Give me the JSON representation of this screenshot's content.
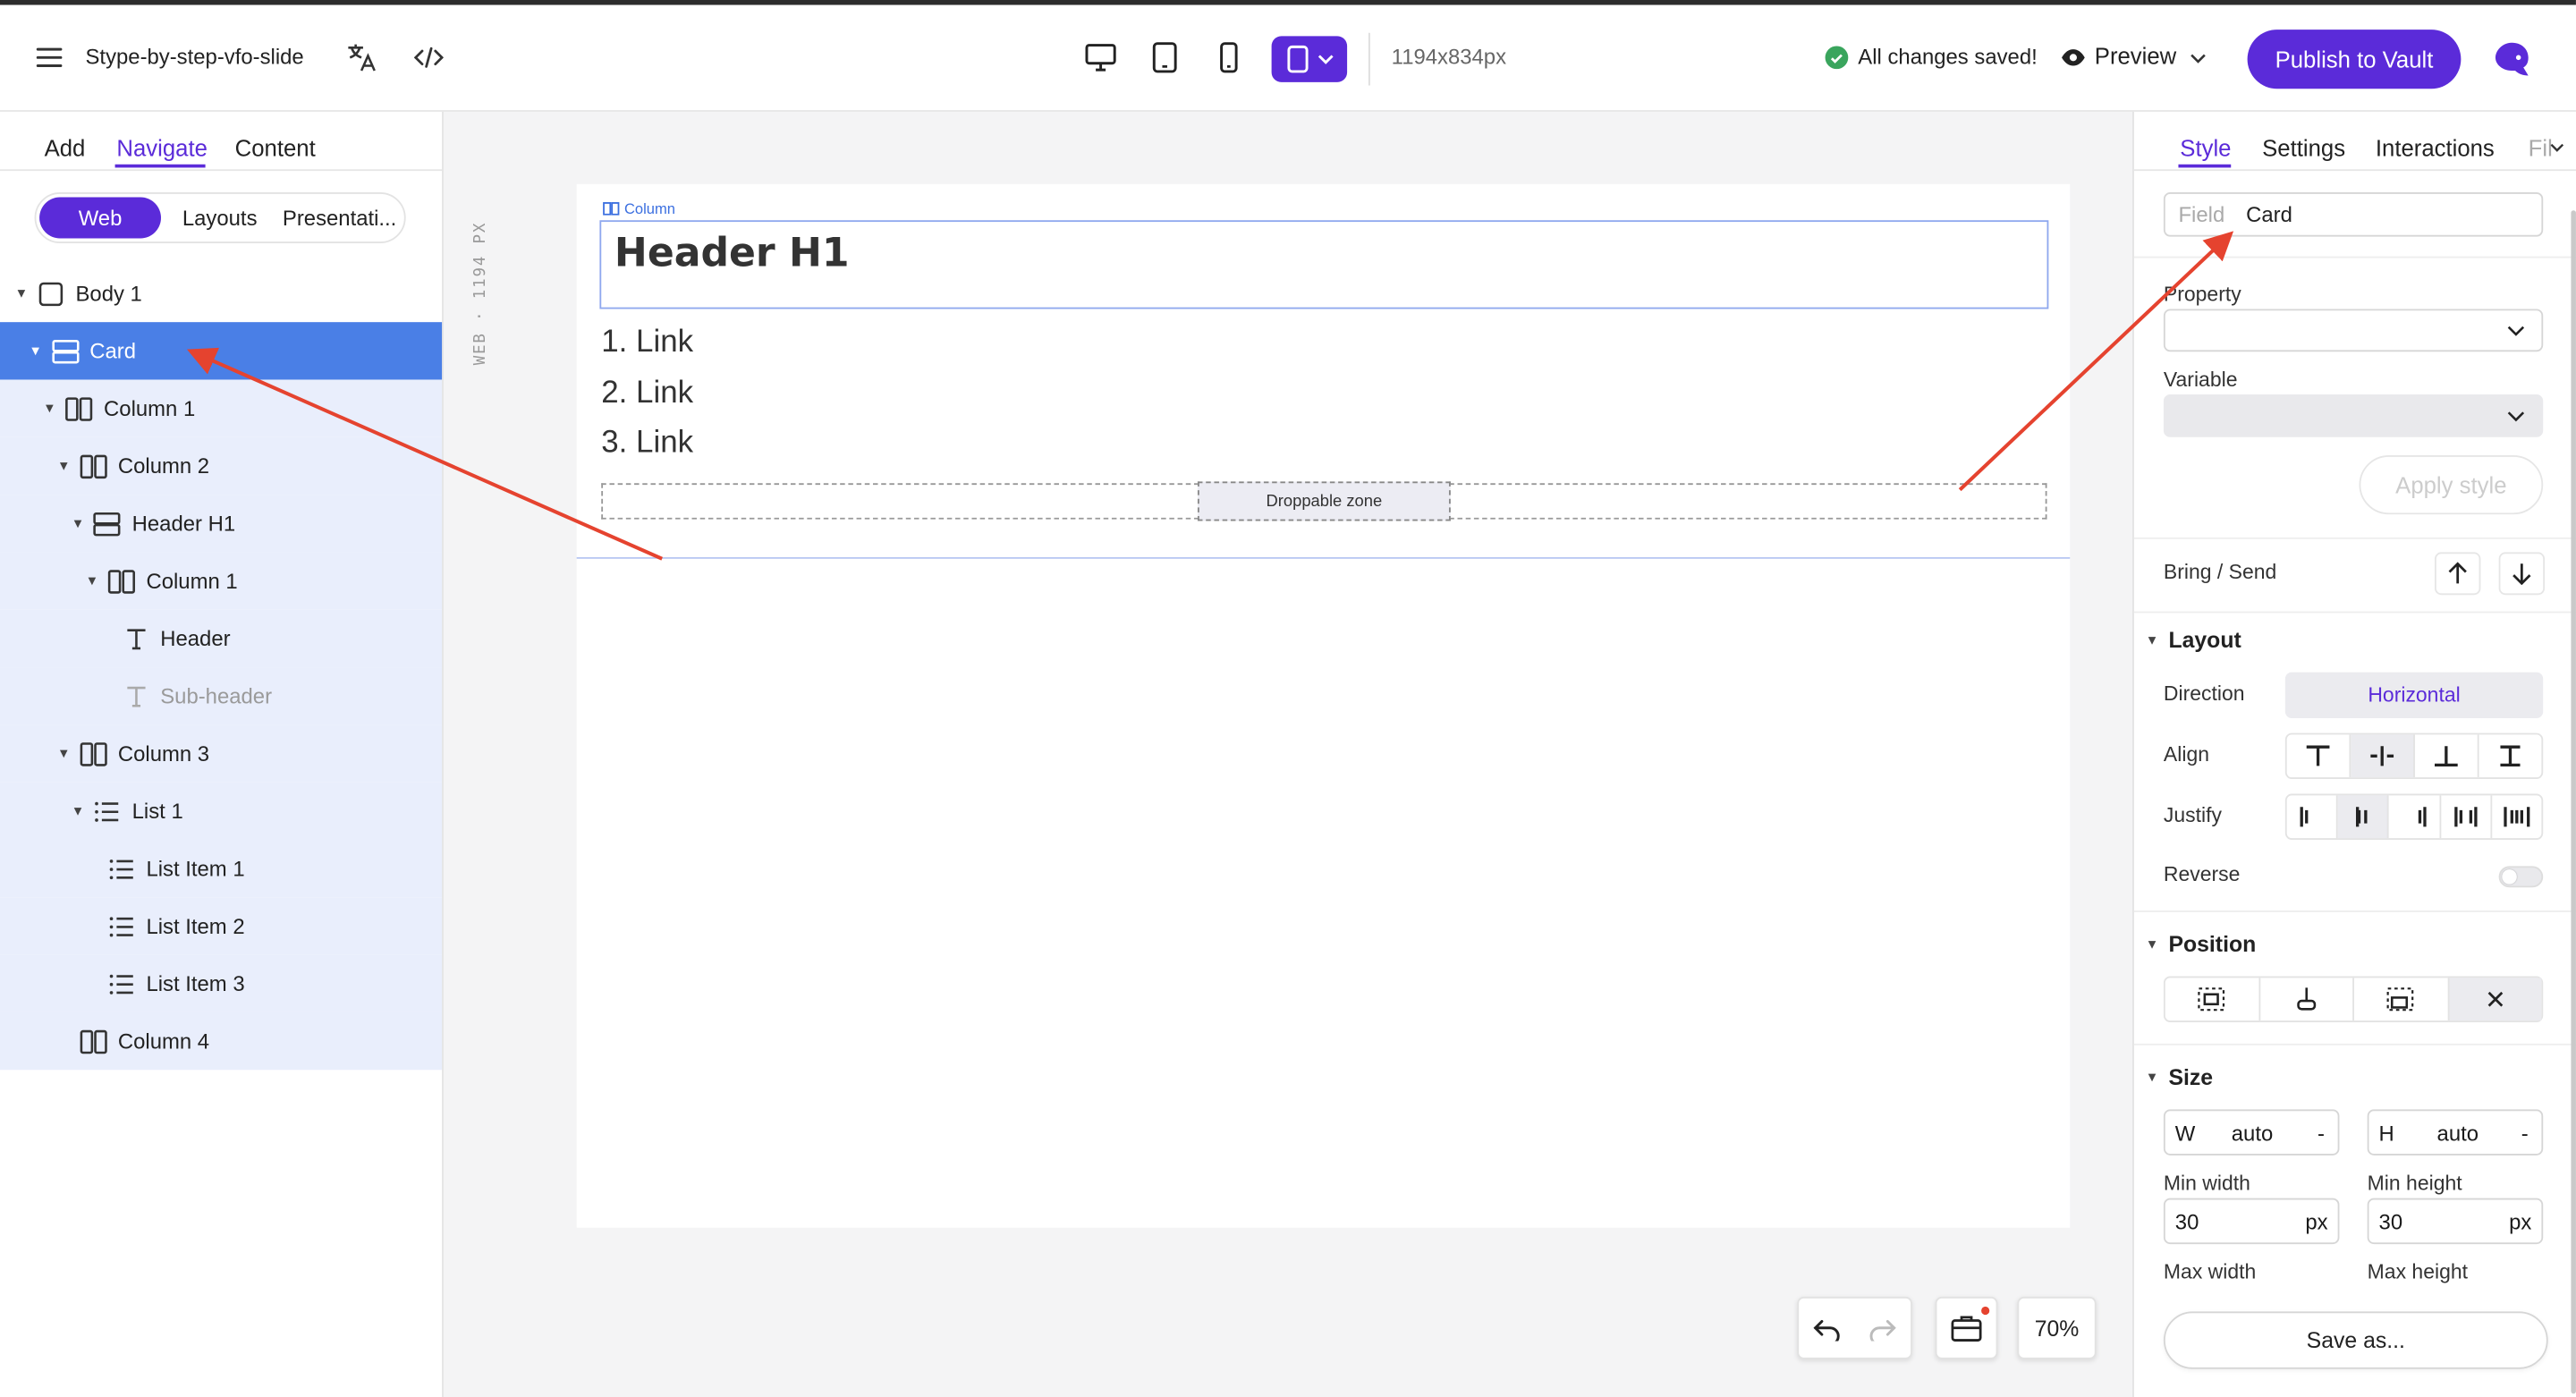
{
  "toolbar": {
    "doc_name": "Stype-by-step-vfo-slide",
    "dimensions": "1194x834px",
    "save_status": "All changes saved!",
    "preview_label": "Preview",
    "publish_label": "Publish to Vault"
  },
  "left_panel": {
    "tabs": [
      "Add",
      "Navigate",
      "Content"
    ],
    "active_tab": "Navigate",
    "modes": [
      "Web",
      "Layouts",
      "Presentati..."
    ],
    "active_mode": "Web",
    "tree": [
      {
        "label": "Body 1",
        "icon": "square-icon",
        "depth": 0
      },
      {
        "label": "Card",
        "icon": "card-icon",
        "depth": 1
      },
      {
        "label": "Column 1",
        "icon": "columns-icon",
        "depth": 2
      },
      {
        "label": "Column 2",
        "icon": "columns-icon",
        "depth": 3
      },
      {
        "label": "Header H1",
        "icon": "card-icon",
        "depth": 4
      },
      {
        "label": "Column 1",
        "icon": "columns-icon",
        "depth": 5
      },
      {
        "label": "Header",
        "icon": "text-icon",
        "depth": 6
      },
      {
        "label": "Sub-header",
        "icon": "text-icon",
        "depth": 6
      },
      {
        "label": "Column 3",
        "icon": "columns-icon",
        "depth": 3
      },
      {
        "label": "List 1",
        "icon": "list-icon",
        "depth": 4
      },
      {
        "label": "List Item 1",
        "icon": "list-icon",
        "depth": 5
      },
      {
        "label": "List Item 2",
        "icon": "list-icon",
        "depth": 5
      },
      {
        "label": "List Item 3",
        "icon": "list-icon",
        "depth": 5
      },
      {
        "label": "Column 4",
        "icon": "columns-icon",
        "depth": 3
      }
    ]
  },
  "canvas": {
    "ruler_label": "WEB · 1194 PX",
    "column_tag": "Column",
    "header_text": "Header H1",
    "links": [
      "1. Link",
      "2. Link",
      "3. Link"
    ],
    "drop_zone": "Droppable zone",
    "zoom": "70%"
  },
  "right_panel": {
    "tabs": [
      "Style",
      "Settings",
      "Interactions",
      "Fil"
    ],
    "active_tab": "Style",
    "field_label": "Field",
    "field_value": "Card",
    "property_label": "Property",
    "variable_label": "Variable",
    "apply_label": "Apply style",
    "bring_send_label": "Bring / Send",
    "layout_title": "Layout",
    "direction_label": "Direction",
    "direction_value": "Horizontal",
    "align_label": "Align",
    "justify_label": "Justify",
    "reverse_label": "Reverse",
    "position_title": "Position",
    "size_title": "Size",
    "w_label": "W",
    "w_value": "auto",
    "h_label": "H",
    "h_value": "auto",
    "dash": "-",
    "min_width_label": "Min width",
    "min_width_value": "30",
    "min_height_label": "Min height",
    "min_height_value": "30",
    "unit": "px",
    "max_width_label": "Max width",
    "max_height_label": "Max height",
    "save_as_label": "Save as..."
  },
  "colors": {
    "accent": "#5b2bd9",
    "selected_row": "#4a7fe6",
    "tree_highlight": "#e9eefc",
    "arrow": "#e5432f",
    "saved_check": "#3aa55d"
  }
}
